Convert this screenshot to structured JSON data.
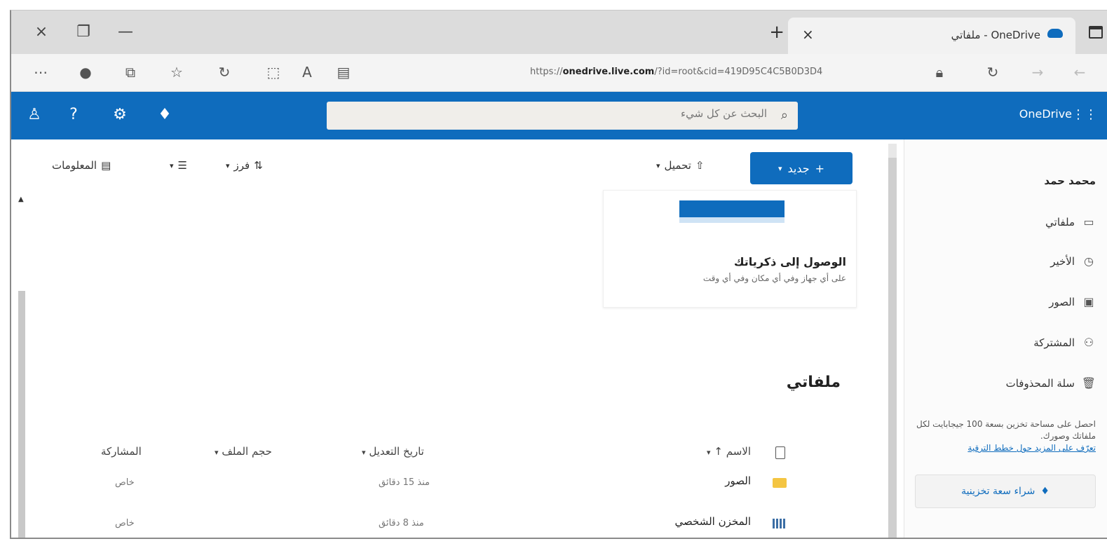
{
  "browser": {
    "tab_title": "OneDrive - ملفاتي",
    "tab_close": "×",
    "new_tab": "+",
    "window_close": "×",
    "window_restore": "❐",
    "window_minimize": "—",
    "url_prefix": "https://",
    "url_host": "onedrive.live.com",
    "url_rest": "/?id=root&cid=419D95C4C5B0D3D4",
    "address_icons": [
      "ellipsis-icon",
      "profile-icon",
      "collections-icon",
      "favorites-icon",
      "refresh-icon",
      "extensions-icon",
      "read-aloud-icon",
      "reader-icon",
      "lock-icon",
      "reload-icon",
      "back-icon",
      "forward-icon"
    ]
  },
  "header": {
    "brand": "OneDrive",
    "search_placeholder": "البحث عن كل شيء",
    "icons": [
      "account-icon",
      "help-icon",
      "settings-icon",
      "premium-diamond-icon",
      "waffle-icon"
    ]
  },
  "nav": {
    "user_name": "محمد حمد",
    "items": [
      {
        "label": "ملفاتي",
        "icon": "folder-icon"
      },
      {
        "label": "الأخير",
        "icon": "clock-icon"
      },
      {
        "label": "الصور",
        "icon": "photo-icon"
      },
      {
        "label": "المشتركة",
        "icon": "people-icon"
      },
      {
        "label": "سلة المحذوفات",
        "icon": "trash-icon"
      }
    ],
    "promo_text": "احصل على مساحة تخزين بسعة 100 جيجابايت لكل ملفاتك وصورك.",
    "promo_link": "تعرّف على المزيد حول خطط الترقية",
    "buy_label": "شراء سعة تخزينية"
  },
  "toolbar": {
    "new_label": "جديد",
    "upload_label": "تحميل",
    "sort_label": "فرز",
    "view_label": "",
    "info_label": "المعلومات"
  },
  "card": {
    "title": "الوصول إلى ذكرياتك",
    "subtitle": "على أي جهاز وفي أي مكان وفي أي وقت"
  },
  "page": {
    "title": "ملفاتي"
  },
  "files": {
    "columns": {
      "name": "الاسم",
      "modified": "تاريخ التعديل",
      "size": "حجم الملف",
      "sharing": "المشاركة"
    },
    "rows": [
      {
        "name": "الصور",
        "modified": "منذ 15 دقائق",
        "size": "",
        "sharing": "خاص",
        "icon": "folder-yellow-icon"
      },
      {
        "name": "المخزن الشخصي",
        "modified": "منذ 8 دقائق",
        "size": "",
        "sharing": "خاص",
        "icon": "personal-vault-icon"
      }
    ]
  }
}
